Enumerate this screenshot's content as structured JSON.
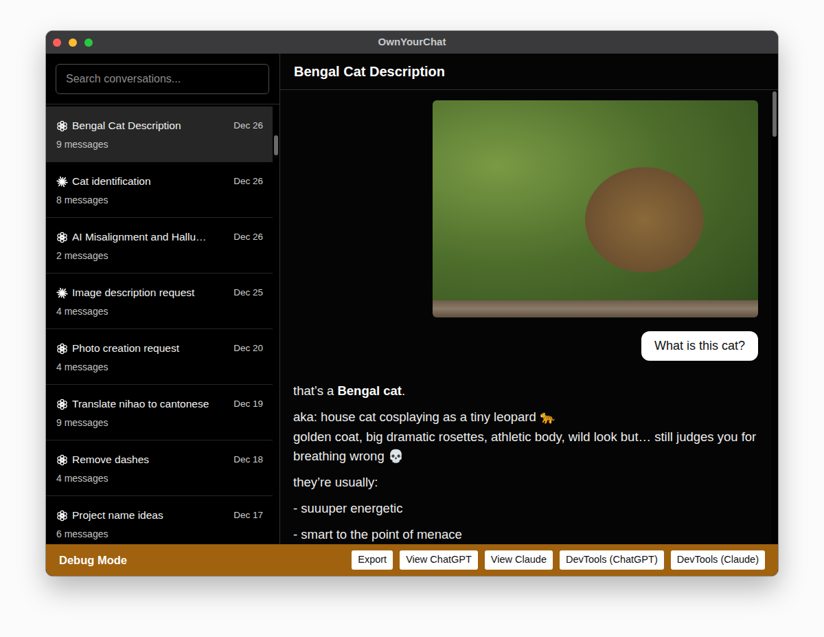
{
  "window": {
    "title": "OwnYourChat"
  },
  "sidebar": {
    "search": {
      "placeholder": "Search conversations..."
    },
    "scroll_thumb": {
      "start": 0.07,
      "length": 0.045
    },
    "items": [
      {
        "title": "Bengal Cat Description",
        "date": "Dec 26",
        "count": "9 messages",
        "kind": "chatgpt",
        "selected": true
      },
      {
        "title": "Cat identification",
        "date": "Dec 26",
        "count": "8 messages",
        "kind": "claude",
        "selected": false
      },
      {
        "title": "AI Misalignment and Hallu…",
        "date": "Dec 26",
        "count": "2 messages",
        "kind": "chatgpt",
        "selected": false
      },
      {
        "title": "Image description request",
        "date": "Dec 25",
        "count": "4 messages",
        "kind": "claude",
        "selected": false
      },
      {
        "title": "Photo creation request",
        "date": "Dec 20",
        "count": "4 messages",
        "kind": "chatgpt",
        "selected": false
      },
      {
        "title": "Translate nihao to cantonese",
        "date": "Dec 19",
        "count": "9 messages",
        "kind": "chatgpt",
        "selected": false
      },
      {
        "title": "Remove dashes",
        "date": "Dec 18",
        "count": "4 messages",
        "kind": "chatgpt",
        "selected": false
      },
      {
        "title": "Project name ideas",
        "date": "Dec 17",
        "count": "6 messages",
        "kind": "chatgpt",
        "selected": false
      }
    ]
  },
  "conversation": {
    "title": "Bengal Cat Description",
    "scroll_thumb": {
      "start": 0.003,
      "length": 0.1
    },
    "messages": [
      {
        "role": "user",
        "kind": "image"
      },
      {
        "role": "user",
        "kind": "text",
        "text": "What is this cat?"
      },
      {
        "role": "assistant",
        "kind": "rich",
        "paragraphs": [
          [
            [
              {
                "text": "that’s a ",
                "bold": false
              },
              {
                "text": "Bengal cat",
                "bold": true
              },
              {
                "text": ".",
                "bold": false
              }
            ]
          ],
          [
            [
              {
                "text": "aka: house cat cosplaying as a tiny leopard 🐆",
                "bold": false
              }
            ],
            [
              {
                "text": "golden coat, big dramatic rosettes, athletic body, wild look but… still judges you for breathing wrong 💀",
                "bold": false
              }
            ]
          ],
          [
            [
              {
                "text": "they’re usually:",
                "bold": false
              }
            ]
          ],
          [
            [
              {
                "text": "- suuuper energetic",
                "bold": false
              }
            ]
          ],
          [
            [
              {
                "text": "- smart to the point of menace",
                "bold": false
              }
            ]
          ]
        ]
      }
    ]
  },
  "debug_bar": {
    "label": "Debug Mode",
    "buttons": [
      "Export",
      "View ChatGPT",
      "View Claude",
      "DevTools (ChatGPT)",
      "DevTools (Claude)"
    ]
  }
}
